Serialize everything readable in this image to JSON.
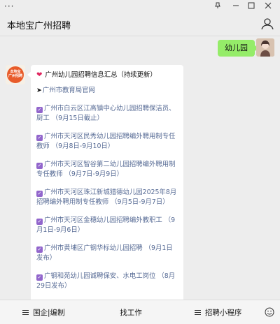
{
  "window": {
    "menu_icon": "ellipsis-icon"
  },
  "header": {
    "title": "本地宝广州招聘"
  },
  "my_message": {
    "text": "幼儿园"
  },
  "bot": {
    "avatar_text_1": "本地宝",
    "avatar_text_2": "广州招聘"
  },
  "bubble": {
    "heading": "广州幼儿园招聘信息汇总（持续更新）",
    "link_top": "广州市教育局官网",
    "items": [
      "广州市白云区江高镇中心幼儿园招聘保洁员、厨工 （9月15日截止）",
      "广州市天河区民秀幼儿园招聘编外聘用制专任教师 （9月8日-9月10日）",
      "广州市天河区智谷第二幼儿园招聘编外聘用制专任教师 （9月7日-9月9日）",
      "广州市天河区珠江新城猎德幼儿园2025年8月招聘编外聘用制专任教师 （9月5日-9月7日）",
      "广州市天河区金穗幼儿园招聘编外教职工 （9月1日-9月6日）",
      "广州市黄埔区广钢华标幼儿园招聘 （9月1日发布）",
      "广钢和苑幼儿园诚聘保安、水电工岗位 （8月29日发布）"
    ]
  },
  "bottombar": {
    "item1": "国企|编制",
    "item2": "找工作",
    "item3": "招聘小程序"
  }
}
